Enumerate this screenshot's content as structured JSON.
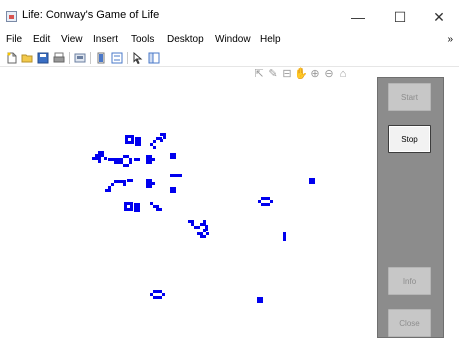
{
  "window": {
    "title": "Life: Conway's Game of Life",
    "minimize": "—",
    "maximize": "☐",
    "close": "✕"
  },
  "menu": {
    "items": [
      "File",
      "Edit",
      "View",
      "Insert",
      "Tools",
      "Desktop",
      "Window",
      "Help"
    ],
    "overflow": "»"
  },
  "toolbar": {
    "icons": [
      "new-figure-icon",
      "open-file-icon",
      "save-icon",
      "print-icon",
      "link-plot-icon",
      "insert-colorbar-icon",
      "insert-legend-icon",
      "pointer-icon",
      "property-inspector-icon"
    ]
  },
  "axes_toolbar": {
    "icons": [
      "export-icon",
      "brush-icon",
      "datatip-icon",
      "pan-icon",
      "zoom-in-icon",
      "zoom-out-icon",
      "home-icon"
    ],
    "glyphs": [
      "⇱",
      "✎",
      "⊟",
      "✋",
      "⊕",
      "⊖",
      "⌂"
    ]
  },
  "controls": {
    "start": "Start",
    "stop": "Stop",
    "info": "Info",
    "close": "Close"
  },
  "colors": {
    "cell": "#0000ee",
    "panel": "#8c8c8c",
    "background": "#ffffff"
  }
}
